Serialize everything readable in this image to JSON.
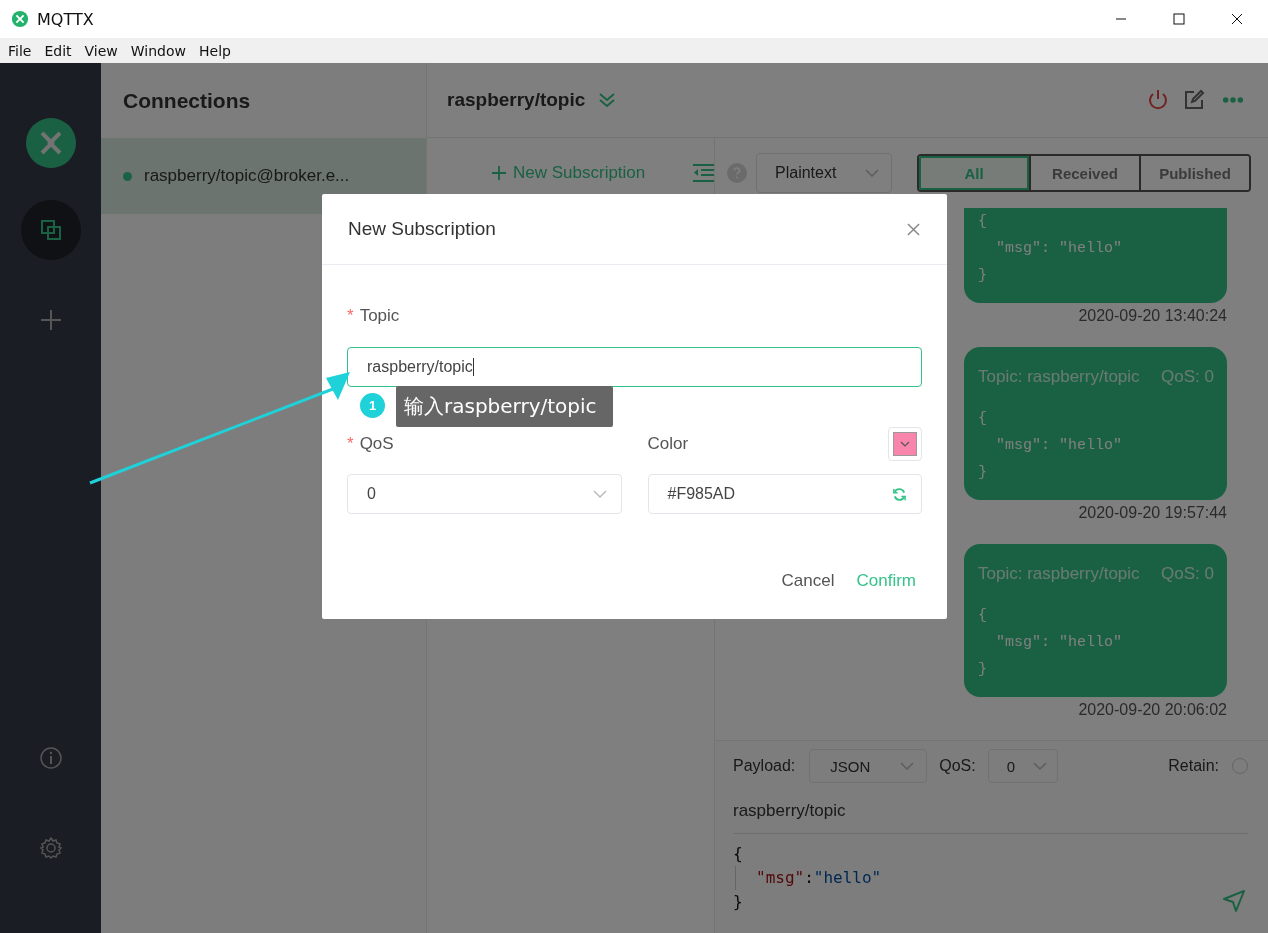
{
  "window": {
    "title": "MQTTX"
  },
  "menu": [
    "File",
    "Edit",
    "View",
    "Window",
    "Help"
  ],
  "sidebar": {
    "items": [
      {
        "kind": "connections",
        "selected": true
      },
      {
        "kind": "add",
        "selected": false
      }
    ],
    "bottom": [
      {
        "kind": "about"
      },
      {
        "kind": "settings"
      }
    ]
  },
  "connections": {
    "title": "Connections",
    "items": [
      {
        "name": "raspberry/topic@broker.e...",
        "selected": true,
        "color": "#1a6244"
      }
    ]
  },
  "header": {
    "title": "raspberry/topic"
  },
  "subscriptions": {
    "new_button": "New Subscription"
  },
  "toolbar": {
    "format": "Plaintext",
    "filters": [
      {
        "label": "All",
        "selected": true
      },
      {
        "label": "Received",
        "selected": false
      },
      {
        "label": "Published",
        "selected": false
      }
    ]
  },
  "messages": [
    {
      "payload": [
        "{",
        "  \"msg\": \"hello\"",
        "}"
      ],
      "time": "2020-09-20 13:40:24"
    },
    {
      "topic": "Topic: raspberry/topic",
      "qos": "QoS: 0",
      "payload": [
        "{",
        "  \"msg\": \"hello\"",
        "}"
      ],
      "time": "2020-09-20 19:57:44"
    },
    {
      "topic": "Topic: raspberry/topic",
      "qos": "QoS: 0",
      "payload": [
        "{",
        "  \"msg\": \"hello\"",
        "}"
      ],
      "time": "2020-09-20 20:06:02"
    }
  ],
  "publish": {
    "payload_label": "Payload:",
    "payload_format": "JSON",
    "qos_label": "QoS:",
    "qos": "0",
    "retain_label": "Retain:",
    "retain": false,
    "topic": "raspberry/topic",
    "editor": {
      "open": "{",
      "entries": [
        {
          "key": "\"msg\"",
          "colon": ":",
          "value": "\"hello\""
        }
      ],
      "close": "}"
    }
  },
  "dialog": {
    "title": "New Subscription",
    "topic_field": {
      "mark": "*",
      "label": "Topic",
      "value": "raspberry/topic",
      "focused": true
    },
    "qos_field": {
      "mark": "*",
      "label": "QoS",
      "value": "0"
    },
    "color_field": {
      "label": "Color",
      "value": "#F985AD",
      "color": "#f985ad"
    },
    "cancel": "Cancel",
    "confirm": "Confirm"
  },
  "annotation": {
    "step": "1",
    "text": "输入raspberry/topic"
  }
}
